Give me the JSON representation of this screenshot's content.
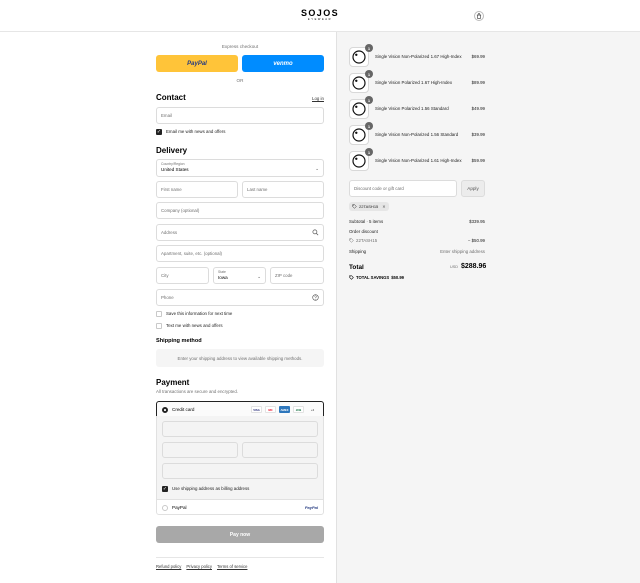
{
  "header": {
    "logo": "SOJOS",
    "logo_sub": "EYEWEAR",
    "cart_icon": "shopping-bag-icon"
  },
  "express": {
    "title": "Express checkout",
    "paypal_label": "PayPal",
    "venmo_label": "venmo",
    "or_label": "OR",
    "paypal_color": "#ffc439",
    "venmo_color": "#008cff"
  },
  "contact": {
    "heading": "Contact",
    "login_link": "Log in",
    "email_placeholder": "Email",
    "email_news_label": "Email me with news and offers",
    "email_news_checked": true
  },
  "delivery": {
    "heading": "Delivery",
    "country_label": "Country/Region",
    "country_value": "United States",
    "first_name_placeholder": "First name",
    "last_name_placeholder": "Last name",
    "company_placeholder": "Company (optional)",
    "address_placeholder": "Address",
    "apartment_placeholder": "Apartment, suite, etc. (optional)",
    "city_placeholder": "City",
    "state_label": "State",
    "state_value": "Iowa",
    "zip_placeholder": "ZIP code",
    "phone_placeholder": "Phone",
    "save_info_label": "Save this information for next time",
    "text_news_label": "Text me with news and offers"
  },
  "shipping": {
    "heading": "Shipping method",
    "notice": "Enter your shipping address to view available shipping methods."
  },
  "payment": {
    "heading": "Payment",
    "subtitle": "All transactions are secure and encrypted.",
    "credit_card_label": "Credit card",
    "brands": [
      "VISA",
      "MC",
      "AMEX",
      "JCB",
      "+4"
    ],
    "billing_same_label": "Use shipping address as billing address",
    "paypal_label": "PayPal",
    "paypal_logo": "PayPal",
    "pay_now_label": "Pay now"
  },
  "footer": {
    "links": [
      "Refund policy",
      "Privacy policy",
      "Terms of service"
    ]
  },
  "order": {
    "items": [
      {
        "qty": "1",
        "name": "Single Vision Non-Polarized 1.67 High-Index",
        "price": "$69.99"
      },
      {
        "qty": "1",
        "name": "Single Vision Polarized 1.67 High-Index",
        "price": "$89.99"
      },
      {
        "qty": "1",
        "name": "Single Vision Polarized 1.56 Standard",
        "price": "$49.99"
      },
      {
        "qty": "1",
        "name": "Single Vision Non-Polarized 1.56 Standard",
        "price": "$39.99"
      },
      {
        "qty": "1",
        "name": "Single Vision Non-Polarized 1.61 High-Index",
        "price": "$59.99"
      }
    ],
    "discount_placeholder": "Discount code or gift card",
    "apply_label": "Apply",
    "code": "22TASH15",
    "subtotal_label": "Subtotal · 5 items",
    "subtotal_value": "$339.95",
    "order_discount_label": "Order discount",
    "discount_code_label": "22TASH15",
    "discount_value": "− $50.99",
    "shipping_label": "Shipping",
    "shipping_value": "Enter shipping address",
    "total_label": "Total",
    "currency": "USD",
    "total_value": "$288.96",
    "savings_label": "TOTAL SAVINGS",
    "savings_value": "$50.99"
  }
}
